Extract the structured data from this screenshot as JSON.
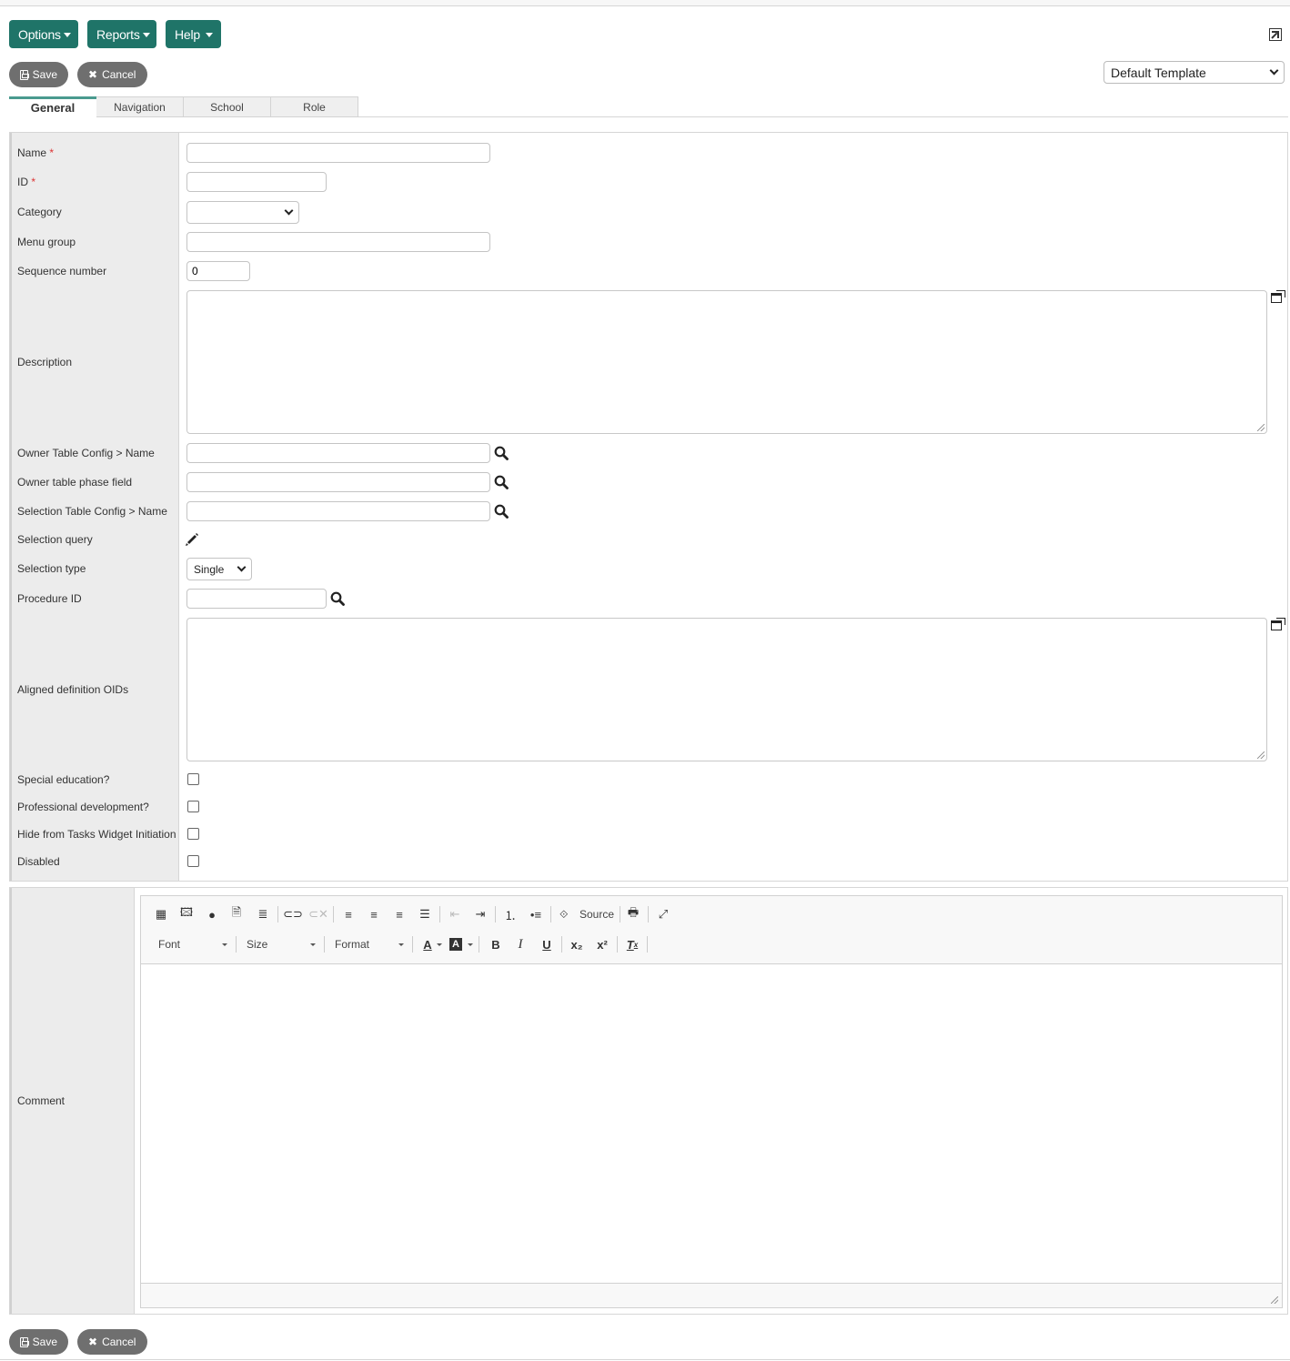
{
  "menus": [
    {
      "label": "Options"
    },
    {
      "label": "Reports"
    },
    {
      "label": "Help"
    }
  ],
  "actions": {
    "save_label": "Save",
    "cancel_label": "Cancel"
  },
  "template_select": {
    "selected": "Default Template"
  },
  "tabs": [
    {
      "label": "General",
      "active": true
    },
    {
      "label": "Navigation",
      "active": false
    },
    {
      "label": "School",
      "active": false
    },
    {
      "label": "Role",
      "active": false
    }
  ],
  "form": {
    "name": {
      "label": "Name",
      "required_marker": "*",
      "value": ""
    },
    "id": {
      "label": "ID",
      "required_marker": "*",
      "value": ""
    },
    "category": {
      "label": "Category",
      "selected": ""
    },
    "menu_group": {
      "label": "Menu group",
      "value": ""
    },
    "sequence_number": {
      "label": "Sequence number",
      "value": "0"
    },
    "description": {
      "label": "Description",
      "value": ""
    },
    "owner_table_config": {
      "label": "Owner Table Config > Name",
      "value": ""
    },
    "owner_table_phase": {
      "label": "Owner table phase field",
      "value": ""
    },
    "selection_table_config": {
      "label": "Selection Table Config > Name",
      "value": ""
    },
    "selection_query": {
      "label": "Selection query"
    },
    "selection_type": {
      "label": "Selection type",
      "selected": "Single"
    },
    "procedure_id": {
      "label": "Procedure ID",
      "value": ""
    },
    "aligned_oids": {
      "label": "Aligned definition OIDs",
      "value": ""
    },
    "special_education": {
      "label": "Special education?",
      "checked": false
    },
    "professional_development": {
      "label": "Professional development?",
      "checked": false
    },
    "hide_from_tasks": {
      "label": "Hide from Tasks Widget Initiation",
      "checked": false
    },
    "disabled": {
      "label": "Disabled",
      "checked": false
    }
  },
  "comment": {
    "label": "Comment",
    "toolbar": {
      "source_label": "Source",
      "font_label": "Font",
      "size_label": "Size",
      "format_label": "Format"
    }
  },
  "colors": {
    "menu_bg": "#1f7468",
    "pill_bg": "#6f6f6f",
    "tab_active": "#4a9a8f",
    "label_col_bg": "#ececec",
    "required": "#dd3333"
  }
}
